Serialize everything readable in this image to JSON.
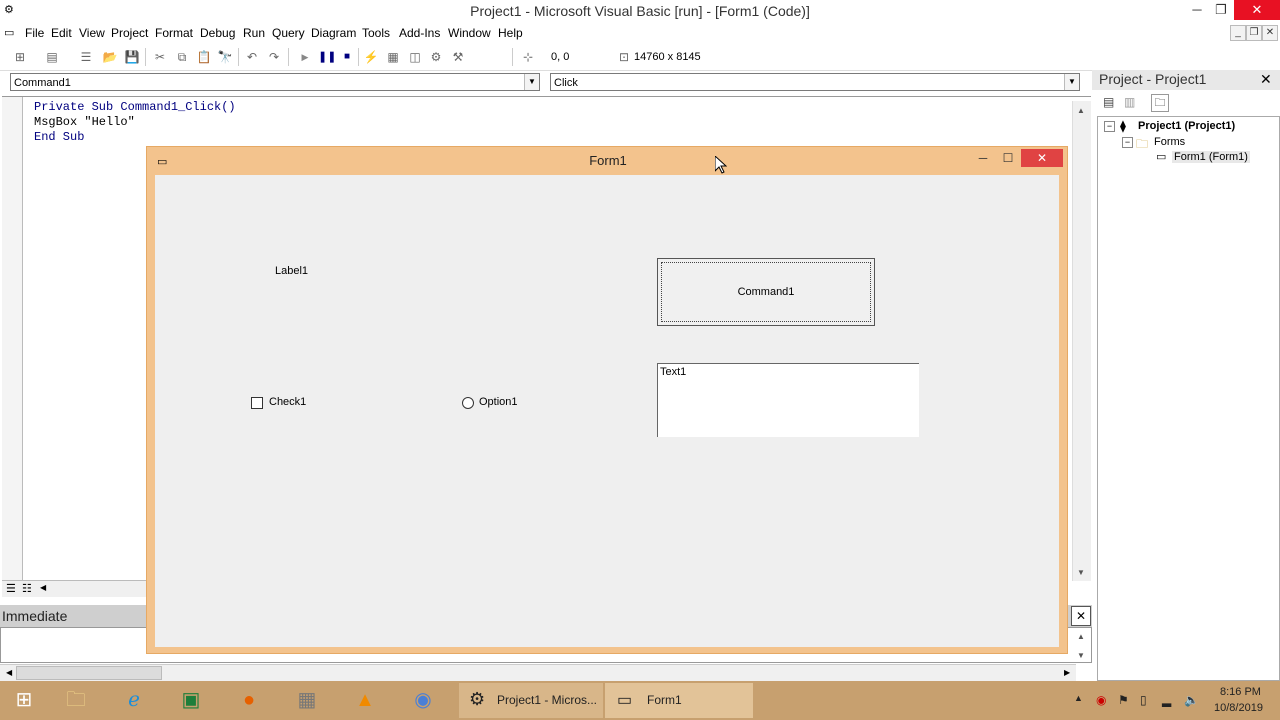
{
  "window": {
    "title": "Project1 - Microsoft Visual Basic [run] - [Form1 (Code)]",
    "minimize_glyph": "─",
    "restore_glyph": "❐",
    "close_glyph": "✕"
  },
  "menubar": {
    "items": [
      "File",
      "Edit",
      "View",
      "Project",
      "Format",
      "Debug",
      "Run",
      "Query",
      "Diagram",
      "Tools",
      "Add-Ins",
      "Window",
      "Help"
    ]
  },
  "toolbar": {
    "position_readout": "0, 0",
    "size_readout": "14760 x 8145"
  },
  "code_window": {
    "object_combo": "Command1",
    "procedure_combo": "Click",
    "lines": [
      "Private Sub Command1_Click()",
      "MsgBox \"Hello\"",
      "End Sub"
    ]
  },
  "immediate": {
    "title": "Immediate",
    "close_glyph": "✕"
  },
  "project_explorer": {
    "title": "Project - Project1",
    "close_glyph": "✕",
    "tree": {
      "project": "Project1 (Project1)",
      "folder": "Forms",
      "form": "Form1 (Form1)"
    }
  },
  "form1": {
    "title": "Form1",
    "label": "Label1",
    "command_button": "Command1",
    "text_box": "Text1",
    "check_box": "Check1",
    "option_button": "Option1",
    "close_glyph": "✕",
    "min_glyph": "─",
    "max_glyph": "☐"
  },
  "taskbar": {
    "apps": [
      "Project1 - Micros...",
      "Form1"
    ],
    "time": "8:16 PM",
    "date": "10/8/2019"
  },
  "colors": {
    "form_frame": "#f3c38d",
    "taskbar": "#c7a06f",
    "close_red": "#e81123"
  }
}
